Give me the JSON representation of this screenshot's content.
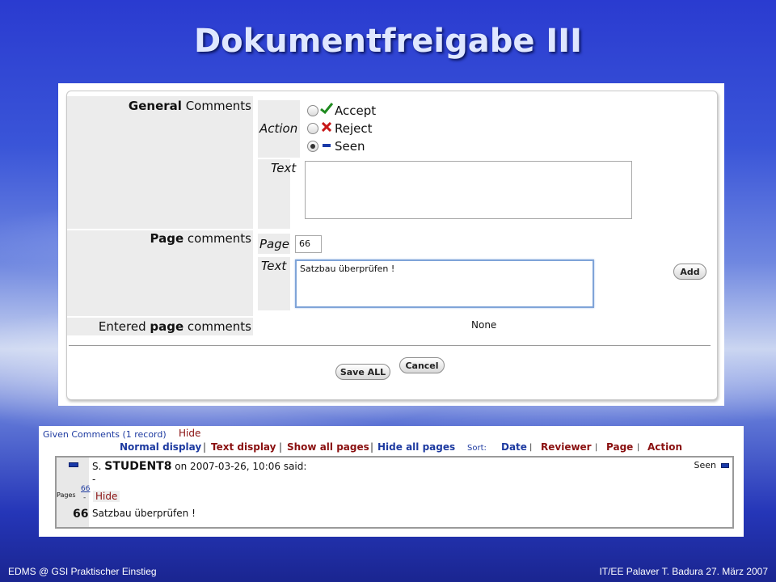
{
  "slide": {
    "title": "Dokumentfreigabe III",
    "footer_left": "EDMS @ GSI Praktischer Einstieg",
    "footer_right": "IT/EE Palaver T. Badura 27. März 2007"
  },
  "form": {
    "general_bold": "General",
    "general_rest": " Comments",
    "action_label": "Action",
    "options": [
      {
        "label": "Accept",
        "icon": "green-check-icon",
        "selected": false
      },
      {
        "label": "Reject",
        "icon": "red-x-icon",
        "selected": false
      },
      {
        "label": "Seen",
        "icon": "blue-dash-icon",
        "selected": true
      }
    ],
    "text_label": "Text",
    "general_text_value": "",
    "page_bold": "Page",
    "page_rest": " comments",
    "page_label": "Page",
    "page_value": "66",
    "page_text_label": "Text",
    "page_text_value": "Satzbau überprüfen !",
    "add_button": "Add",
    "entered_pre": "Entered ",
    "entered_bold": "page",
    "entered_post": " comments",
    "entered_value": "None",
    "save_all_button": "Save ALL",
    "cancel_button": "Cancel"
  },
  "comments": {
    "header": "Given Comments (1 record)",
    "hide": "Hide",
    "normal_display": "Normal display",
    "text_display": "Text display",
    "show_all_pages": "Show all pages",
    "hide_all_pages": "Hide all pages",
    "sort_label": "Sort:",
    "sort_date": "Date",
    "sort_reviewer": "Reviewer",
    "sort_page": "Page",
    "sort_action": "Action",
    "separator": "|",
    "entry": {
      "prefix": "S.",
      "user": "STUDENT8",
      "date_text": "on 2007-03-26, 10:06 said:",
      "status": "Seen",
      "dash": "-",
      "pages_label": "Pages",
      "page_link": "66",
      "page_dash": "-",
      "hide": "Hide",
      "page_number": "66",
      "comment": "Satzbau überprüfen !"
    }
  }
}
